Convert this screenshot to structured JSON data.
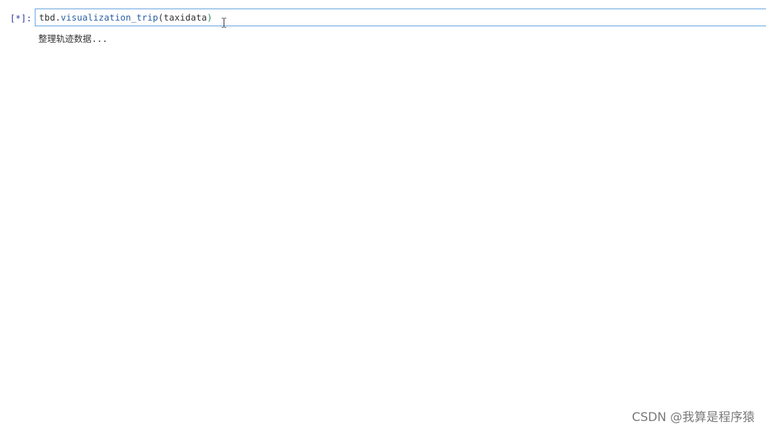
{
  "cell": {
    "prompt": "[*]:",
    "code": {
      "object": "tbd",
      "dot": ".",
      "function": "visualization_trip",
      "open_paren": "(",
      "argument": "taxidata",
      "close_paren": ")"
    }
  },
  "output": {
    "text": "整理轨迹数据..."
  },
  "watermark": {
    "text": "CSDN @我算是程序猿"
  },
  "cursor_icon": "i-beam-cursor-icon",
  "colors": {
    "prompt": "#303f9f",
    "function": "#2a5fa4",
    "close_paren": "#2e8b57",
    "editor_border": "#66a3e0"
  }
}
